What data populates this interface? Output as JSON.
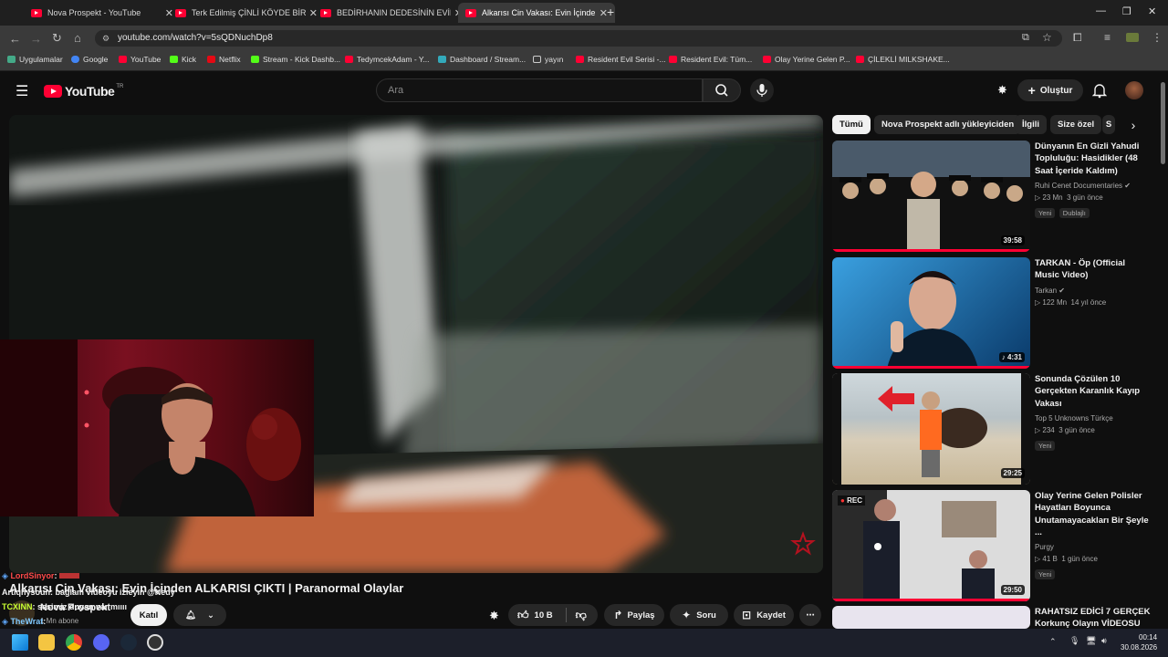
{
  "browser": {
    "tabs": [
      {
        "label": "Nova Prospekt - YouTube"
      },
      {
        "label": "Terk Edilmiş ÇİNLİ KÖYDE BİR GECE"
      },
      {
        "label": "BEDİRHANIN DEDESİNİN EVİNDE"
      },
      {
        "label": "Alkarısı Cin Vakası: Evin İçinden"
      }
    ],
    "url": "youtube.com/watch?v=5sQDNuchDp8",
    "bookmarks": [
      "Uygulamalar",
      "Google",
      "YouTube",
      "Kick",
      "Netflix",
      "Stream - Kick Dashb...",
      "TedymcekAdam - Y...",
      "Dashboard / Stream...",
      "yayın",
      "Resident Evil Serisi -...",
      "Resident Evil: Tüm...",
      "Olay Yerine Gelen P...",
      "ÇİLEKLİ MILKSHAKE..."
    ]
  },
  "youtube": {
    "logo": "YouTube",
    "region": "TR",
    "search_placeholder": "Ara",
    "create_label": "Oluştur"
  },
  "video": {
    "title": "Alkarısı Cin Vakası: Evin İçinden ALKARISI ÇIKTI | Paranormal Olaylar",
    "channel": "Nova Prospekt",
    "subscribers": "1 Mn abone",
    "join_label": "Katıl",
    "likes": "10 B",
    "share_label": "Paylaş",
    "ask_label": "Soru",
    "save_label": "Kaydet"
  },
  "chat": [
    {
      "user": "LordSinyor",
      "text": ""
    },
    {
      "user": "Artiqhysoun",
      "text": "bağlam videoyu izleyin @Nedy"
    },
    {
      "user": "TCXINN",
      "text": "sesimiz duyan var mıııı"
    },
    {
      "user": "TheWrat",
      "text": ""
    }
  ],
  "filters": [
    "Tümü",
    "Nova Prospekt adlı yükleyiciden",
    "İlgili",
    "Size özel",
    "S"
  ],
  "recommendations": [
    {
      "title": "Dünyanın En Gizli Yahudi Topluluğu: Hasidikler (48 Saat İçeride Kaldım)",
      "channel": "Ruhi Cenet Documentaries",
      "views": "23 Mn",
      "age": "3 gün önce",
      "duration": "39:58",
      "badges": [
        "Yeni",
        "Dublajlı"
      ]
    },
    {
      "title": "TARKAN - Öp (Official Music Video)",
      "channel": "Tarkan",
      "views": "122 Mn",
      "age": "14 yıl önce",
      "duration": "4:31",
      "badges": []
    },
    {
      "title": "Sonunda Çözülen 10 Gerçekten Karanlık Kayıp Vakası",
      "channel": "Top 5 Unknowns Türkçe",
      "views": "234",
      "age": "3 gün önce",
      "duration": "29:25",
      "badges": [
        "Yeni"
      ]
    },
    {
      "title": "Olay Yerine Gelen Polisler Hayatları Boyunca Unutamayacakları Bir Şeyle ...",
      "channel": "Purgy",
      "views": "41 B",
      "age": "1 gün önce",
      "duration": "29:50",
      "badges": [
        "Yeni"
      ]
    },
    {
      "title": "RAHATSIZ EDİCİ 7 GERÇEK Korkunç Olayın VİDEOSU",
      "channel": "",
      "views": "",
      "age": "",
      "duration": "",
      "badges": []
    }
  ],
  "rec_overlay": "REC",
  "taskbar": {
    "time": "00:14",
    "date": "30.08.2026"
  }
}
